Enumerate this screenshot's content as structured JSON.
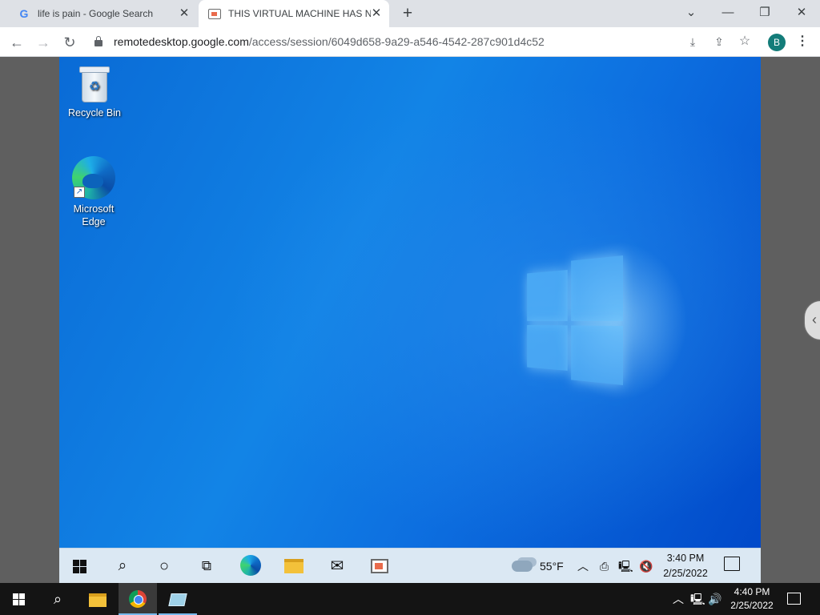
{
  "browser": {
    "tabs": [
      {
        "title": "life is pain - Google Search",
        "icon": "google-g-icon",
        "active": false
      },
      {
        "title": "THIS VIRTUAL MACHINE HAS NC",
        "icon": "remote-desktop-icon",
        "active": true
      }
    ],
    "new_tab_label": "+",
    "window_controls": {
      "tab_search": "⌄",
      "minimize": "—",
      "restore": "❐",
      "close": "✕"
    },
    "url_host": "remotedesktop.google.com",
    "url_path": "/access/session/6049d658-9a29-a546-4542-287c901d4c52",
    "profile_initial": "B",
    "accent_color": "#137c79"
  },
  "remote_desktop": {
    "icons": [
      {
        "label": "Recycle Bin",
        "icon": "recycle-bin-icon"
      },
      {
        "label": "Microsoft Edge",
        "icon": "edge-icon"
      }
    ],
    "taskbar": {
      "items": [
        "start-icon",
        "search-icon",
        "cortana-icon",
        "task-view-icon",
        "edge-icon",
        "file-explorer-icon",
        "mail-icon",
        "remote-desktop-icon"
      ],
      "weather": "55°F",
      "time": "3:40 PM",
      "date": "2/25/2022"
    }
  },
  "local_taskbar": {
    "items": [
      "start-icon",
      "search-icon",
      "file-explorer-icon",
      "chrome-icon",
      "remote-desktop-icon"
    ],
    "time": "4:40 PM",
    "date": "2/25/2022"
  }
}
